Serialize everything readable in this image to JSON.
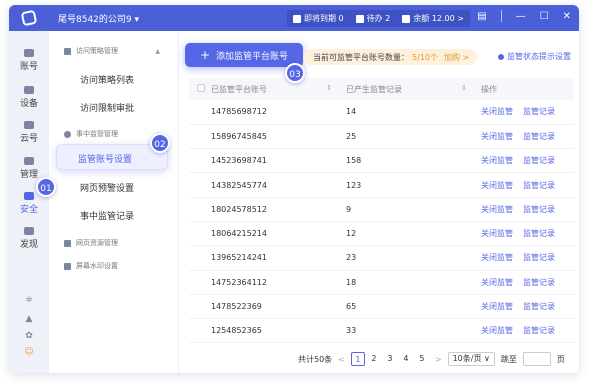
{
  "titlebar": {
    "account": "尾号8542的公司9 ▾",
    "expiring": "即将到期 0",
    "todo": "待办 2",
    "balance": "余额 12.00 >",
    "controls": "| — ☐ ✕"
  },
  "leftnav": {
    "items": [
      "账号",
      "设备",
      "云号",
      "管理",
      "安全",
      "发现"
    ]
  },
  "subnav": {
    "section1": "访问策略管理",
    "section1_items": [
      "访问策略列表",
      "访问限制审批"
    ],
    "section2": "事中监管管理",
    "section2_items": [
      "监管账号设置",
      "网页预警设置",
      "事中监管记录"
    ],
    "section3": "网页资源管理",
    "section4": "屏幕水印设置"
  },
  "badges": [
    "01",
    "02",
    "03"
  ],
  "toolbar": {
    "add_button": "添加监管平台账号",
    "quota_prefix": "当前可监管平台账号数量：",
    "quota_value": "5/10个",
    "quota_link": "加购 >",
    "tip": "监管状态提示设置"
  },
  "table": {
    "headers": [
      "已监管平台账号",
      "已产生监管记录",
      "操作"
    ],
    "rows": [
      {
        "account": "14785698712",
        "records": "14"
      },
      {
        "account": "15896745845",
        "records": "25"
      },
      {
        "account": "14523698741",
        "records": "158"
      },
      {
        "account": "14382545774",
        "records": "123"
      },
      {
        "account": "18024578512",
        "records": "9"
      },
      {
        "account": "18064215214",
        "records": "12"
      },
      {
        "account": "13965214241",
        "records": "23"
      },
      {
        "account": "14752364112",
        "records": "18"
      },
      {
        "account": "1478522369",
        "records": "65"
      },
      {
        "account": "1254852365",
        "records": "33"
      }
    ],
    "action_close": "关闭监管",
    "action_records": "监管记录"
  },
  "pagination": {
    "total": "共计50条",
    "pages": [
      "1",
      "2",
      "3",
      "4",
      "5"
    ],
    "current": "1",
    "page_size": "10条/页 ∨",
    "jump_label": "跳至",
    "page_suffix": "页"
  },
  "colors": {
    "accent": "#5566e6",
    "titlebar": "#4a5fd8",
    "quota_bg": "#fdf1dc",
    "quota_text": "#e69a2a"
  }
}
